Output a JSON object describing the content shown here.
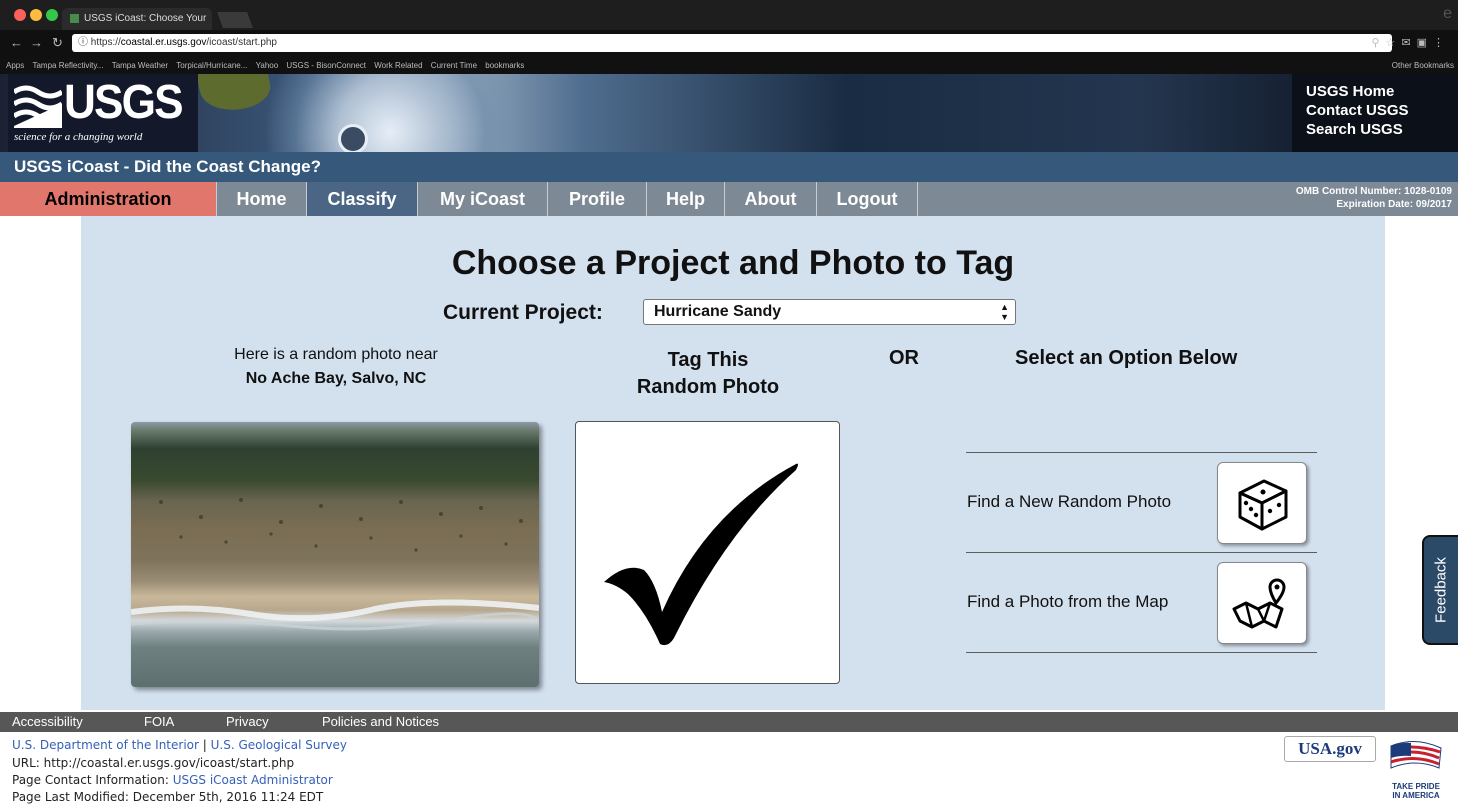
{
  "browser": {
    "tab_title": "USGS iCoast: Choose Your Ph",
    "tab_close": "×",
    "url_scheme": "https://",
    "url_host": "coastal.er.usgs.gov",
    "url_path": "/icoast/start.php",
    "bookmarks": [
      "Apps",
      "Tampa Reflectivity...",
      "Tampa Weather",
      "Torpical/Hurricane...",
      "Yahoo",
      "USGS - BisonConnect",
      "Work Related",
      "Current Time",
      "bookmarks"
    ],
    "other_bookmarks": "Other Bookmarks"
  },
  "header": {
    "logo_word": "USGS",
    "logo_tagline": "science for a changing world",
    "links": [
      "USGS Home",
      "Contact USGS",
      "Search USGS"
    ],
    "subtitle": "USGS iCoast - Did the Coast Change?"
  },
  "nav": {
    "items": [
      "Administration",
      "Home",
      "Classify",
      "My iCoast",
      "Profile",
      "Help",
      "About",
      "Logout"
    ],
    "omb_line1": "OMB Control Number: 1028-0109",
    "omb_line2": "Expiration Date: 09/2017"
  },
  "main": {
    "heading": "Choose a Project and Photo to Tag",
    "project_label": "Current Project:",
    "project_value": "Hurricane Sandy",
    "random_intro": "Here is a random photo near",
    "random_location": "No Ache Bay, Salvo, NC",
    "tag_title_line1": "Tag This",
    "tag_title_line2": "Random Photo",
    "or_label": "OR",
    "options_heading": "Select an Option Below",
    "options": [
      {
        "label": "Find a New Random Photo",
        "icon": "dice-icon"
      },
      {
        "label": "Find a Photo from the Map",
        "icon": "map-pin-icon"
      }
    ]
  },
  "feedback_tab": "Feedback",
  "footer": {
    "links": [
      "Accessibility",
      "FOIA",
      "Privacy",
      "Policies and Notices"
    ],
    "doi": "U.S. Department of the Interior",
    "separator": "|",
    "usgs": "U.S. Geological Survey",
    "url_line": "URL: http://coastal.er.usgs.gov/icoast/start.php",
    "contact_label": "Page Contact Information:",
    "contact_link": "USGS iCoast Administrator",
    "modified": "Page Last Modified: December 5th, 2016 11:24 EDT",
    "usagov": "USA.gov",
    "tpa_line1": "TAKE PRIDE",
    "tpa_line2": "IN AMERICA"
  }
}
